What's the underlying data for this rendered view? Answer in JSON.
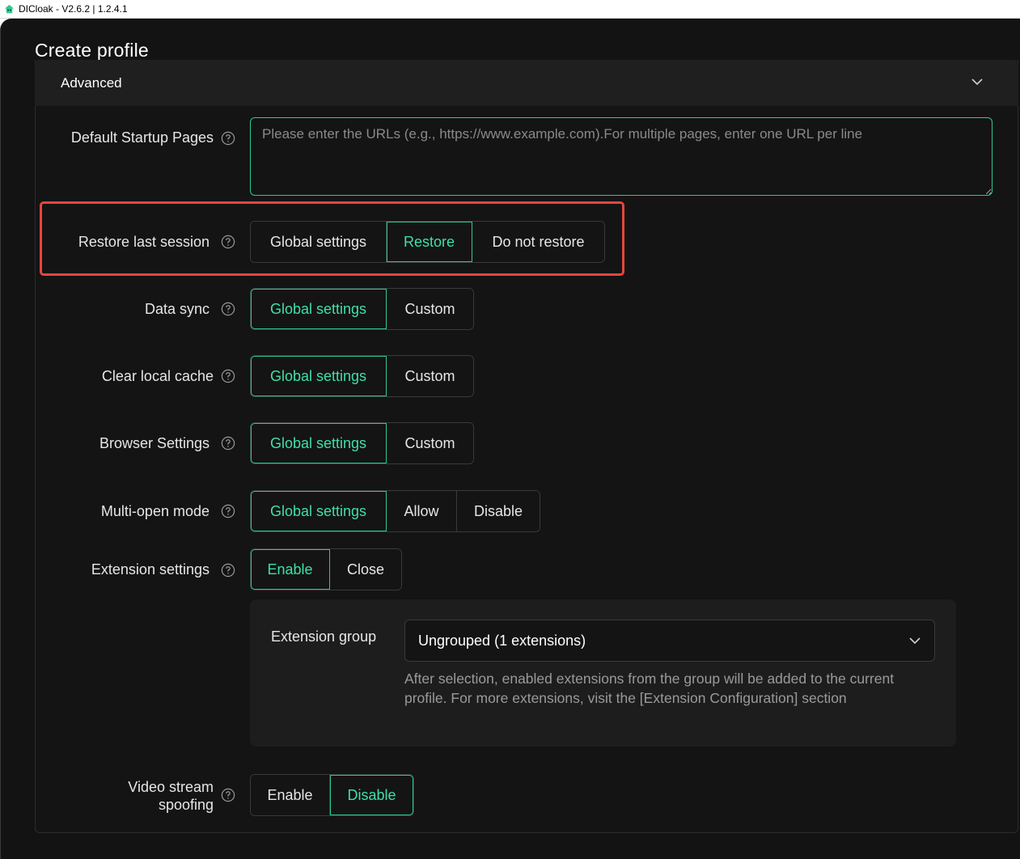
{
  "window": {
    "title": "DICloak - V2.6.2 | 1.2.4.1"
  },
  "page": {
    "title": "Create profile"
  },
  "section": {
    "title": "Advanced"
  },
  "startup_pages": {
    "label": "Default Startup Pages",
    "placeholder": "Please enter the URLs (e.g., https://www.example.com).For multiple pages, enter one URL per line",
    "value": ""
  },
  "restore_session": {
    "label": "Restore last session",
    "options": [
      "Global settings",
      "Restore",
      "Do not restore"
    ],
    "selected": "Restore"
  },
  "data_sync": {
    "label": "Data sync",
    "options": [
      "Global settings",
      "Custom"
    ],
    "selected": "Global settings"
  },
  "clear_cache": {
    "label": "Clear local cache",
    "options": [
      "Global settings",
      "Custom"
    ],
    "selected": "Global settings"
  },
  "browser_settings": {
    "label": "Browser Settings",
    "options": [
      "Global settings",
      "Custom"
    ],
    "selected": "Global settings"
  },
  "multi_open": {
    "label": "Multi-open mode",
    "options": [
      "Global settings",
      "Allow",
      "Disable"
    ],
    "selected": "Global settings"
  },
  "extension_settings": {
    "label": "Extension settings",
    "options": [
      "Enable",
      "Close"
    ],
    "selected": "Enable",
    "group_label": "Extension group",
    "group_value": "Ungrouped (1 extensions)",
    "help_text": "After selection, enabled extensions from the group will be added to the current profile. For more extensions, visit the [Extension Configuration] section"
  },
  "video_spoofing": {
    "label_line1": "Video stream",
    "label_line2": "spoofing",
    "options": [
      "Enable",
      "Disable"
    ],
    "selected": "Disable"
  },
  "icons": {
    "app": "dicloak-logo-icon",
    "collapse": "chevron-down-icon",
    "help": "question-circle-icon",
    "select": "chevron-down-icon"
  },
  "colors": {
    "background": "#131313",
    "accent": "#3ee0a6",
    "highlight": "#e5463d",
    "header": "#1f1f1f"
  }
}
